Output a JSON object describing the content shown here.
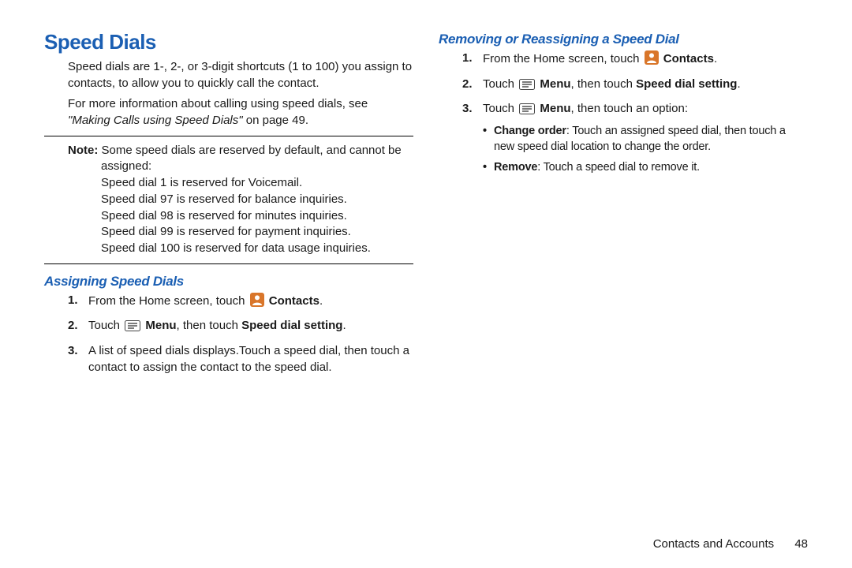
{
  "left": {
    "title": "Speed Dials",
    "p1": "Speed dials are 1-, 2-, or 3-digit shortcuts (1 to 100) you assign to contacts, to allow you to quickly call the contact.",
    "p2_a": "For more information about calling using speed dials, see ",
    "p2_link": "\"Making Calls using Speed Dials\"",
    "p2_b": " on page 49.",
    "note_label": "Note:",
    "note_first": " Some speed dials are reserved by default, and cannot be assigned:",
    "note_lines": [
      "Speed dial 1 is reserved for Voicemail.",
      "Speed dial 97 is reserved for balance inquiries.",
      "Speed dial 98 is reserved for minutes inquiries.",
      "Speed dial 99 is reserved for payment inquiries.",
      "Speed dial 100 is reserved for data usage inquiries."
    ],
    "sub1": "Assigning Speed Dials",
    "s1_1_a": "From the Home screen, touch ",
    "s1_1_b": "Contacts",
    "s1_1_c": ".",
    "s1_2_a": "Touch ",
    "s1_2_menu": "Menu",
    "s1_2_b": ", then touch ",
    "s1_2_setting": "Speed dial setting",
    "s1_2_c": ".",
    "s1_3": "A list of speed dials displays.Touch a speed dial, then touch a contact to assign the contact to the speed dial."
  },
  "right": {
    "sub": "Removing or Reassigning a Speed Dial",
    "r1_a": "From the Home screen, touch ",
    "r1_b": "Contacts",
    "r1_c": ".",
    "r2_a": "Touch ",
    "r2_menu": "Menu",
    "r2_b": ", then touch ",
    "r2_setting": "Speed dial setting",
    "r2_c": ".",
    "r3_a": "Touch ",
    "r3_menu": "Menu",
    "r3_b": ", then touch an option:",
    "b1_label": "Change order",
    "b1_text": ": Touch an assigned speed dial, then touch a new speed dial location to change the order.",
    "b2_label": "Remove",
    "b2_text": ": Touch a speed dial to remove it."
  },
  "footer": {
    "section": "Contacts and Accounts",
    "page": "48"
  }
}
